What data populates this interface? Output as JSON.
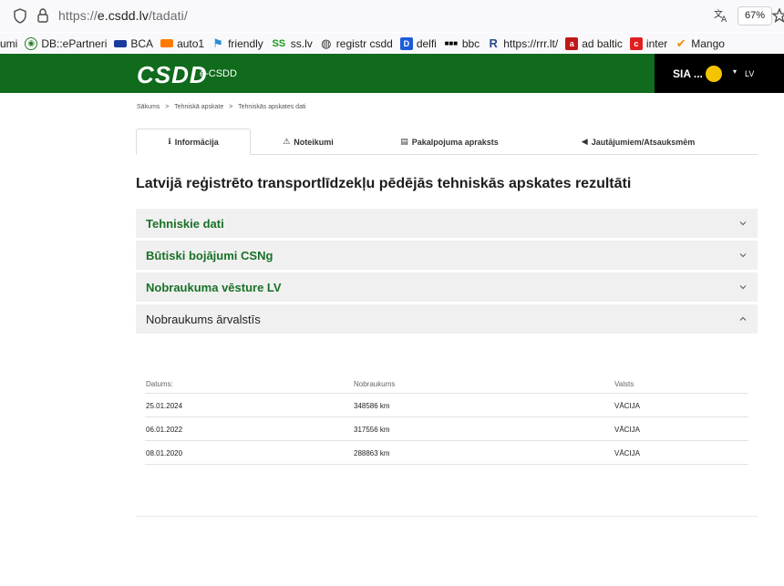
{
  "browser": {
    "url_prefix": "https://",
    "url_domain": "e.csdd.lv",
    "url_path": "/tadati/",
    "zoom": "67%"
  },
  "bookmarks": [
    {
      "label": "umi",
      "icon": "none",
      "color": ""
    },
    {
      "label": "DB::ePartneri",
      "icon": "db-icon",
      "color": "#2a7d2a"
    },
    {
      "label": "BCA",
      "icon": "bca-icon",
      "color": "#1a3a9e"
    },
    {
      "label": "auto1",
      "icon": "auto1-icon",
      "color": "#ff7a00"
    },
    {
      "label": "friendly",
      "icon": "flag-icon",
      "color": "#2a8fd6"
    },
    {
      "label": "ss.lv",
      "icon": "ss-icon",
      "color": "#1a9a1a"
    },
    {
      "label": "registr csdd",
      "icon": "globe-icon",
      "color": "#333333"
    },
    {
      "label": "delfi",
      "icon": "delfi-icon",
      "color": "#1e5bd8"
    },
    {
      "label": "bbc",
      "icon": "bbc-icon",
      "color": "#000000"
    },
    {
      "label": "https://rrr.lt/",
      "icon": "rrr-icon",
      "color": "#2a4a8a"
    },
    {
      "label": "ad baltic",
      "icon": "adbaltic-icon",
      "color": "#c01818"
    },
    {
      "label": "inter",
      "icon": "inter-icon",
      "color": "#e02020"
    },
    {
      "label": "Mango",
      "icon": "mango-icon",
      "color": "#f09000"
    }
  ],
  "header": {
    "logo": "CSDD",
    "subtitle": "e-CSDD",
    "user": "SIA ...",
    "lang": "LV",
    "brand_color": "#106b1d"
  },
  "breadcrumb": [
    "Sākums",
    ">",
    "Tehniskā apskate",
    ">",
    "Tehniskās apskates dati"
  ],
  "tabs": [
    {
      "label": "Informācija",
      "icon": "info-icon",
      "glyph": "ℹ"
    },
    {
      "label": "Noteikumi",
      "icon": "warning-icon",
      "glyph": "⚠"
    },
    {
      "label": "Pakalpojuma apraksts",
      "icon": "document-icon",
      "glyph": "▤"
    },
    {
      "label": "Jautājumiem/Atsauksmēm",
      "icon": "megaphone-icon",
      "glyph": "📢"
    }
  ],
  "page_title": "Latvijā reģistrēto transportlīdzekļu pēdējās tehniskās apskates rezultāti",
  "sections": [
    {
      "title": "Tehniskie dati",
      "open": false
    },
    {
      "title": "Būtiski bojājumi CSNg",
      "open": false
    },
    {
      "title": "Nobraukuma vēsture LV",
      "open": false
    },
    {
      "title": "Nobraukums ārvalstīs",
      "open": true
    }
  ],
  "mileage_table": {
    "headers": [
      "Datums:",
      "Nobraukums",
      "Valsts"
    ],
    "rows": [
      [
        "25.01.2024",
        "348586 km",
        "VĀCIJA"
      ],
      [
        "06.01.2022",
        "317556 km",
        "VĀCIJA"
      ],
      [
        "08.01.2020",
        "288863 km",
        "VĀCIJA"
      ]
    ]
  }
}
